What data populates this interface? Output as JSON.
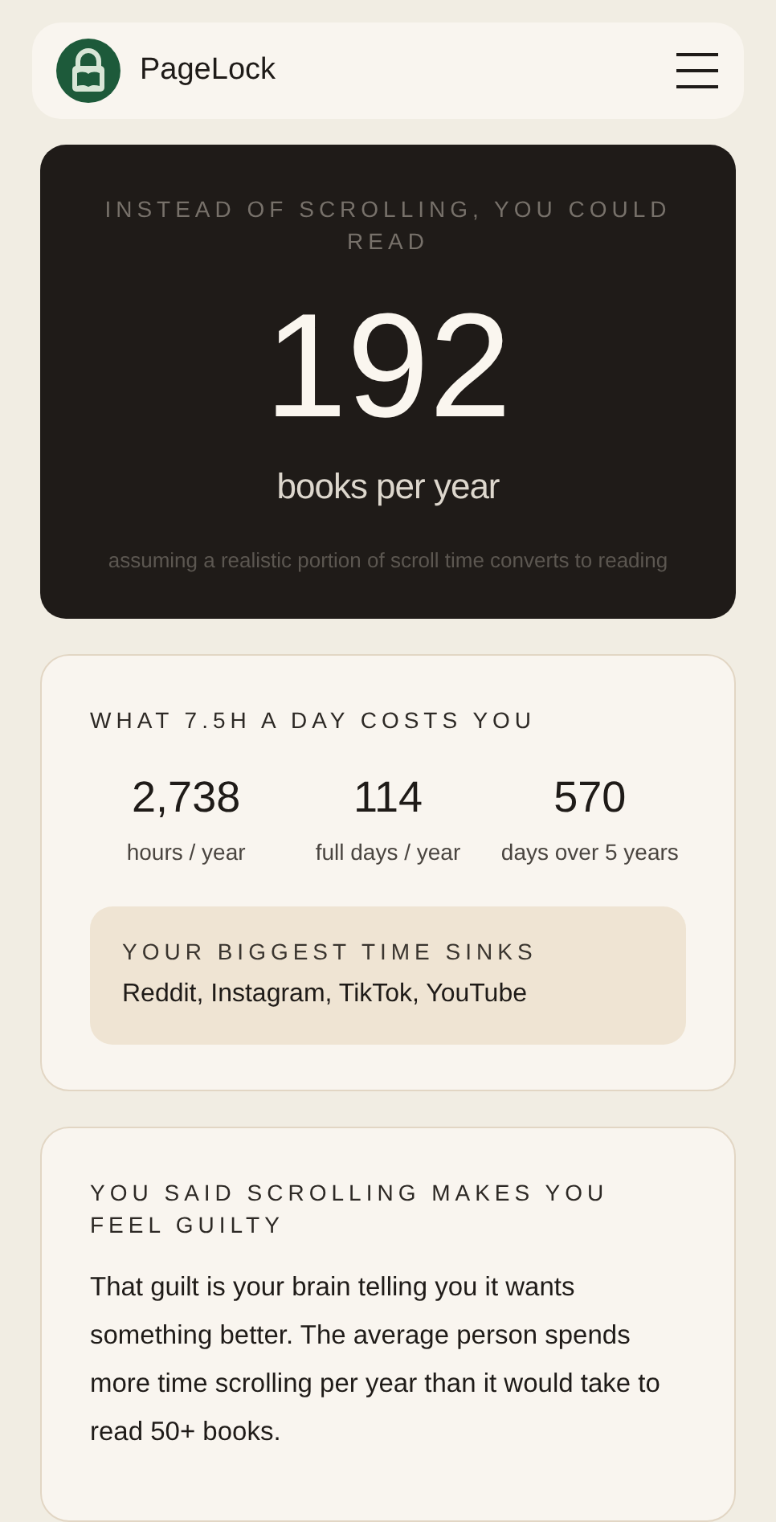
{
  "header": {
    "app_name": "PageLock"
  },
  "hero": {
    "label": "INSTEAD OF SCROLLING, YOU COULD READ",
    "number": "192",
    "unit": "books per year",
    "note": "assuming a realistic portion of scroll time converts to reading"
  },
  "costs": {
    "title": "WHAT 7.5H A DAY COSTS YOU",
    "stats": [
      {
        "value": "2,738",
        "label": "hours / year"
      },
      {
        "value": "114",
        "label": "full days / year"
      },
      {
        "value": "570",
        "label": "days over 5 years"
      }
    ],
    "sinks": {
      "title": "YOUR BIGGEST TIME SINKS",
      "text": "Reddit, Instagram, TikTok, YouTube"
    }
  },
  "feeling": {
    "title": "YOU SAID SCROLLING MAKES YOU FEEL GUILTY",
    "text": "That guilt is your brain telling you it wants something better. The average person spends more time scrolling per year than it would take to read 50+ books."
  }
}
